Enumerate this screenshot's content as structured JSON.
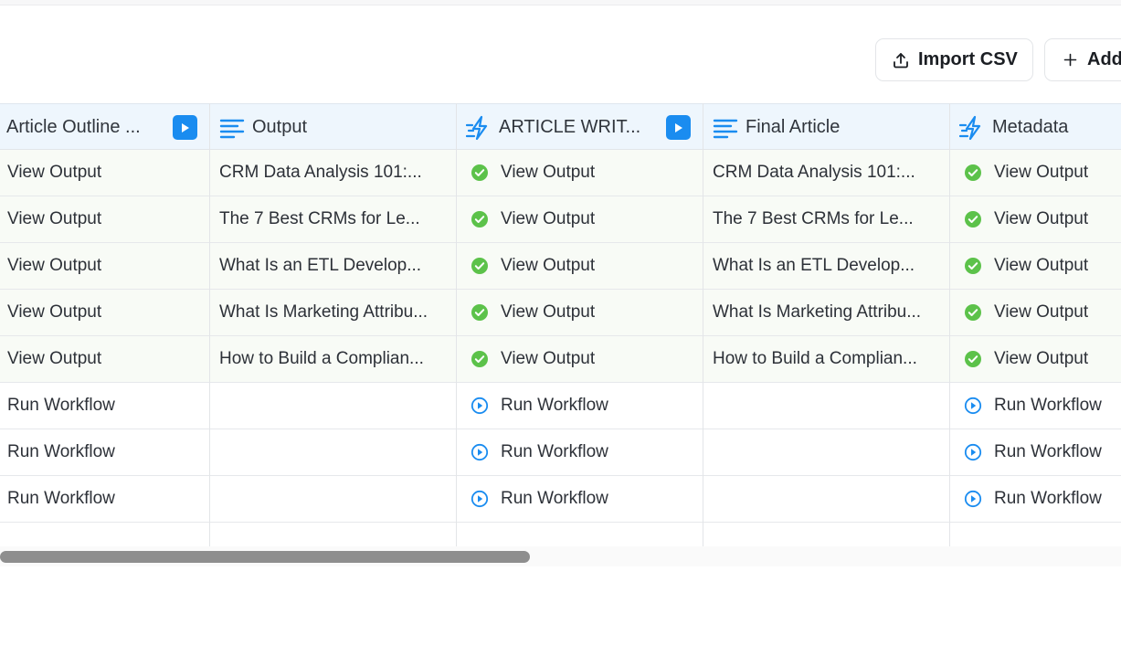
{
  "toolbar": {
    "import_label": "Import CSV",
    "add_label": "Add"
  },
  "columns": [
    {
      "label": "Article Outline ...",
      "icon": "none",
      "has_run": true
    },
    {
      "label": "Output",
      "icon": "text-lines-icon",
      "has_run": false
    },
    {
      "label": "ARTICLE WRIT...",
      "icon": "lightning-icon",
      "has_run": true
    },
    {
      "label": "Final Article",
      "icon": "text-lines-icon",
      "has_run": false
    },
    {
      "label": "Metadata",
      "icon": "lightning-icon",
      "has_run": false
    }
  ],
  "rows": [
    {
      "status": "done",
      "c0": "View Output",
      "c1": "CRM Data Analysis 101:...",
      "c2": "View Output",
      "c3": "CRM Data Analysis 101:...",
      "c4": "View Output"
    },
    {
      "status": "done",
      "c0": "View Output",
      "c1": "The 7 Best CRMs for Le...",
      "c2": "View Output",
      "c3": "The 7 Best CRMs for Le...",
      "c4": "View Output"
    },
    {
      "status": "done",
      "c0": "View Output",
      "c1": "What Is an ETL Develop...",
      "c2": "View Output",
      "c3": "What Is an ETL Develop...",
      "c4": "View Output"
    },
    {
      "status": "done",
      "c0": "View Output",
      "c1": "What Is Marketing Attribu...",
      "c2": "View Output",
      "c3": "What Is Marketing Attribu...",
      "c4": "View Output"
    },
    {
      "status": "done",
      "c0": "View Output",
      "c1": "How to Build a Complian...",
      "c2": "View Output",
      "c3": "How to Build a Complian...",
      "c4": "View Output"
    },
    {
      "status": "pending",
      "c0": "Run Workflow",
      "c1": "",
      "c2": "Run Workflow",
      "c3": "",
      "c4": "Run Workflow"
    },
    {
      "status": "pending",
      "c0": "Run Workflow",
      "c1": "",
      "c2": "Run Workflow",
      "c3": "",
      "c4": "Run Workflow"
    },
    {
      "status": "pending",
      "c0": "Run Workflow",
      "c1": "",
      "c2": "Run Workflow",
      "c3": "",
      "c4": "Run Workflow"
    }
  ],
  "colors": {
    "accent": "#1a8cf0",
    "success": "#5cc24a",
    "header_bg": "#eef6fd",
    "row_filled_bg": "#f8fbf6"
  }
}
